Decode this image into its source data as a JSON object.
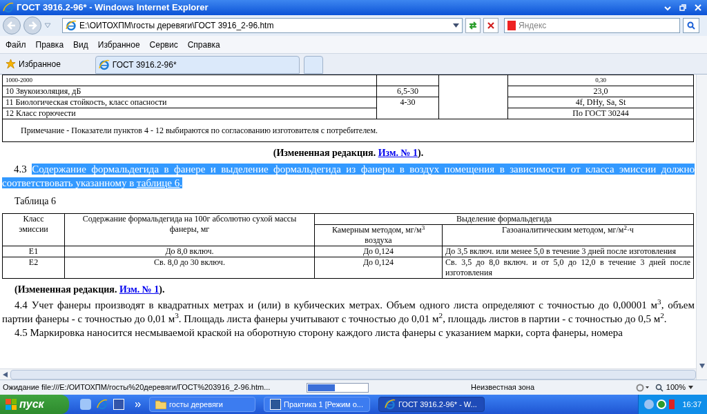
{
  "window": {
    "title": "ГОСТ 3916.2-96* - Windows Internet Explorer"
  },
  "address": {
    "value": "E:\\ОИТОХПМ\\госты деревяги\\ГОСТ 3916_2-96.htm",
    "search_placeholder": "Яндекс"
  },
  "menu": [
    "Файл",
    "Правка",
    "Вид",
    "Избранное",
    "Сервис",
    "Справка"
  ],
  "favorites": {
    "label": "Избранное",
    "tabs": [
      {
        "label": "ГОСТ 3916.2-96*",
        "selected": true
      }
    ]
  },
  "top_table": {
    "rows": [
      [
        "1000-2000",
        "",
        "0,30"
      ],
      [
        "10 Звукоизоляция, дБ",
        "6,5-30",
        "23,0"
      ],
      [
        "11 Биологическая стойкость, класс опасности",
        {
          "text": "4-30",
          "rowspan": 2
        },
        "4f, DHy, Sa, St"
      ],
      [
        "12 Класс горючести",
        "По ГОСТ 30244"
      ]
    ],
    "note": "Примечание - Показатели пунктов 4 - 12 выбираются по согласованию изготовителя с потребителем."
  },
  "amendment_1": {
    "prefix": "(Измененная редакция. ",
    "link": "Изм. № 1",
    "suffix": ")."
  },
  "para_4_3": {
    "number": "4.3",
    "text": "Содержание формальдегида в фанере и выделение формальдегида из фанеры в воздух помещения в зависимости от класса эмиссии должно соответствовать указанному в ",
    "link": "таблице 6",
    "end": ".",
    "selected": true
  },
  "table_6": {
    "caption": "Таблица 6",
    "headers": [
      "Класс эмиссии",
      "Содержание формальдегида на 100г абсолютно сухой массы фанеры, мг",
      "Выделение формальдегида",
      "Камерным методом, мг/м$^{3}$ воздуха",
      "Газоаналитическим методом, мг/м$^{2}$·ч"
    ],
    "rows": [
      [
        "E1",
        "До 8,0 включ.",
        "До 0,124",
        "До 3,5 включ. или менее 5,0 в течение 3 дней после изготовления"
      ],
      [
        "E2",
        "Св. 8,0 до 30 включ.",
        "До 0,124",
        "Св. 3,5 до 8,0 включ. и от 5,0 до 12,0 в течение 3 дней после изготовления"
      ]
    ]
  },
  "amendment_2": {
    "prefix": "(Измененная редакция. ",
    "link": "Изм. № 1",
    "suffix": ")."
  },
  "para_4_4": "4.4 Учет фанеры производят в квадратных метрах и (или) в кубических метрах. Объем одного листа определяют с точностью до 0,00001 м$^{3}$, объем партии фанеры - с точностью до 0,01 м$^{3}$. Площадь листа фанеры учитывают с точностью до 0,01 м$^{2}$, площадь листов в партии - с точностью до 0,5 м$^{2}$.",
  "para_4_5": "4.5 Маркировка наносится несмываемой краской на оборотную сторону каждого листа фанеры с указанием марки, сорта фанеры, номера",
  "status_bar": {
    "text": "Ожидание file:///E:/ОИТОХПМ/госты%20деревяги/ГОСТ%203916_2-96.htm...",
    "level": 0.45,
    "zone": "Неизвестная зона",
    "zoom": "100%"
  },
  "taskbar": {
    "start": "пуск",
    "items": [
      {
        "label": "госты деревяги",
        "kind": "folder",
        "selected": false
      },
      {
        "label": "Практика 1 [Режим о...",
        "kind": "word",
        "selected": false
      },
      {
        "label": "ГОСТ 3916.2-96* - W...",
        "kind": "ie",
        "selected": true
      }
    ],
    "time": "16:37"
  }
}
